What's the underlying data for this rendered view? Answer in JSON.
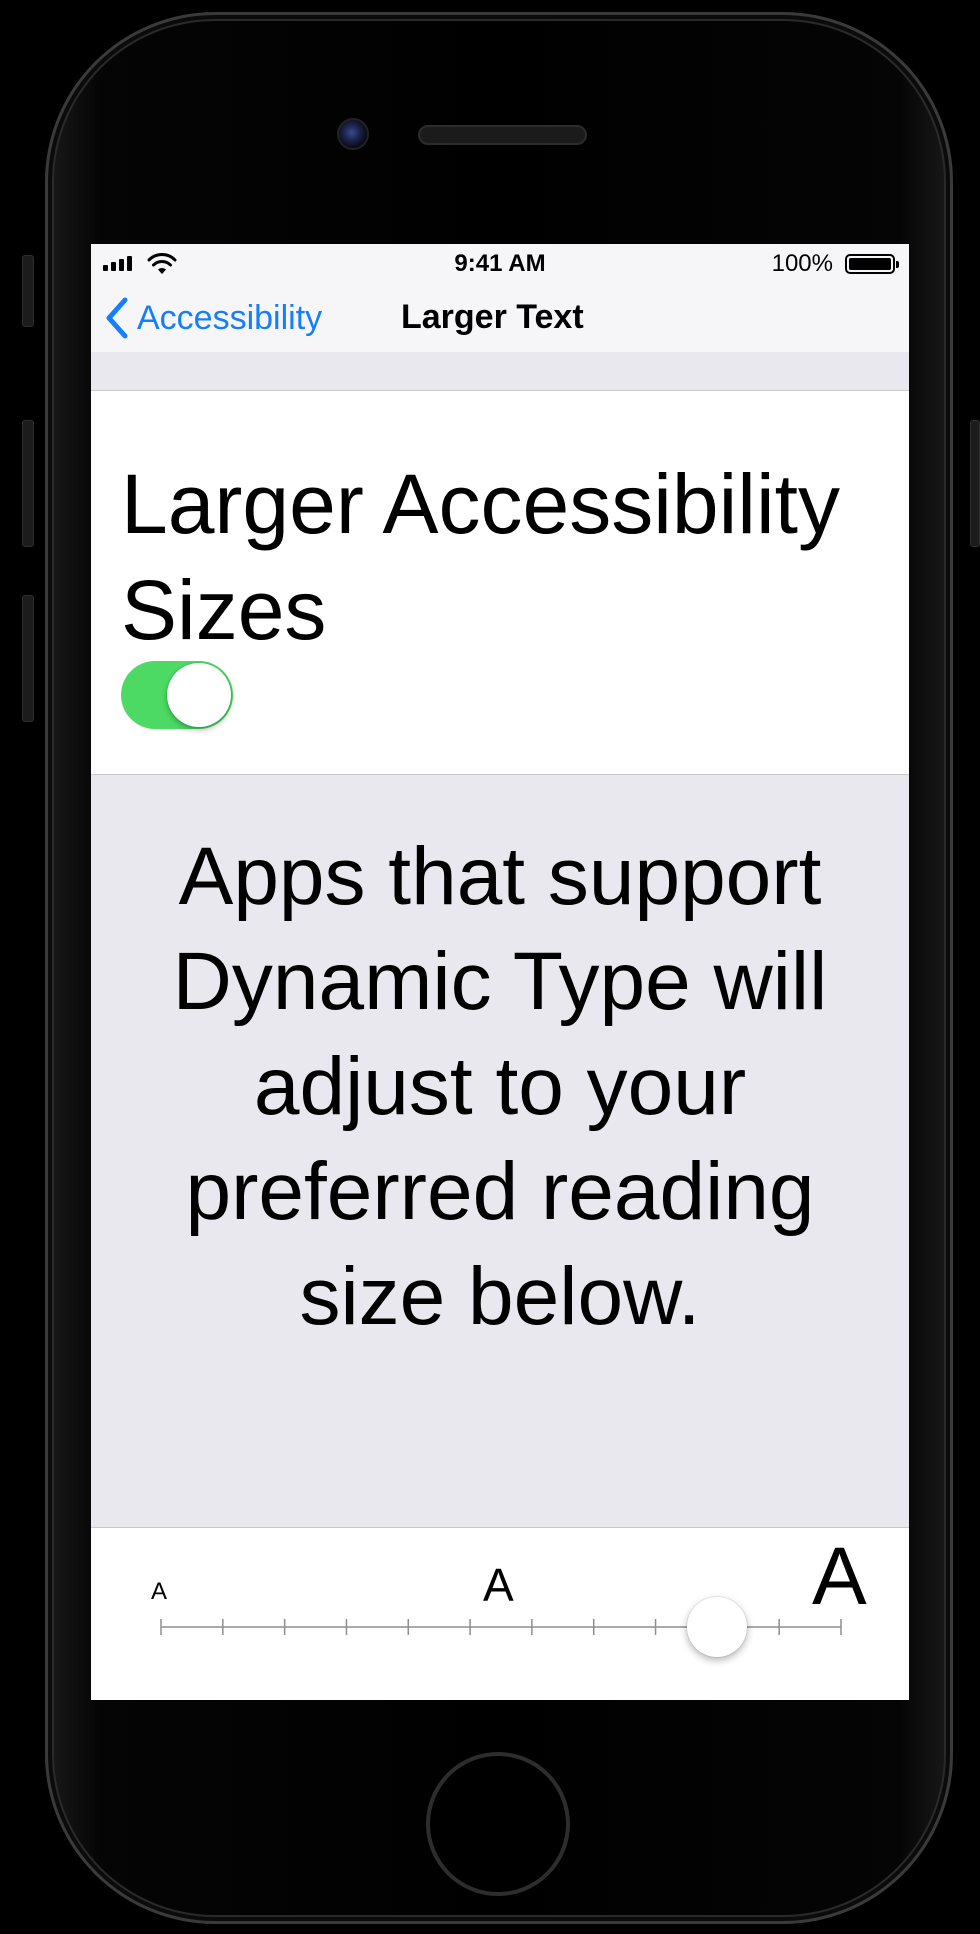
{
  "status_bar": {
    "time": "9:41 AM",
    "battery_percent": "100%",
    "signal_bars": 4,
    "icons": [
      "signal-icon",
      "wifi-icon",
      "battery-icon"
    ]
  },
  "nav": {
    "back_label": "Accessibility",
    "title": "Larger Text",
    "accent_color": "#157efb"
  },
  "toggle": {
    "label": "Larger Accessibility Sizes",
    "on": true,
    "on_color": "#4cd964"
  },
  "description": "Apps that support Dynamic Type will adjust to your preferred reading size below.",
  "slider": {
    "min_glyph": "A",
    "mid_glyph": "A",
    "max_glyph": "A",
    "tick_count": 12,
    "selected_index": 9
  }
}
